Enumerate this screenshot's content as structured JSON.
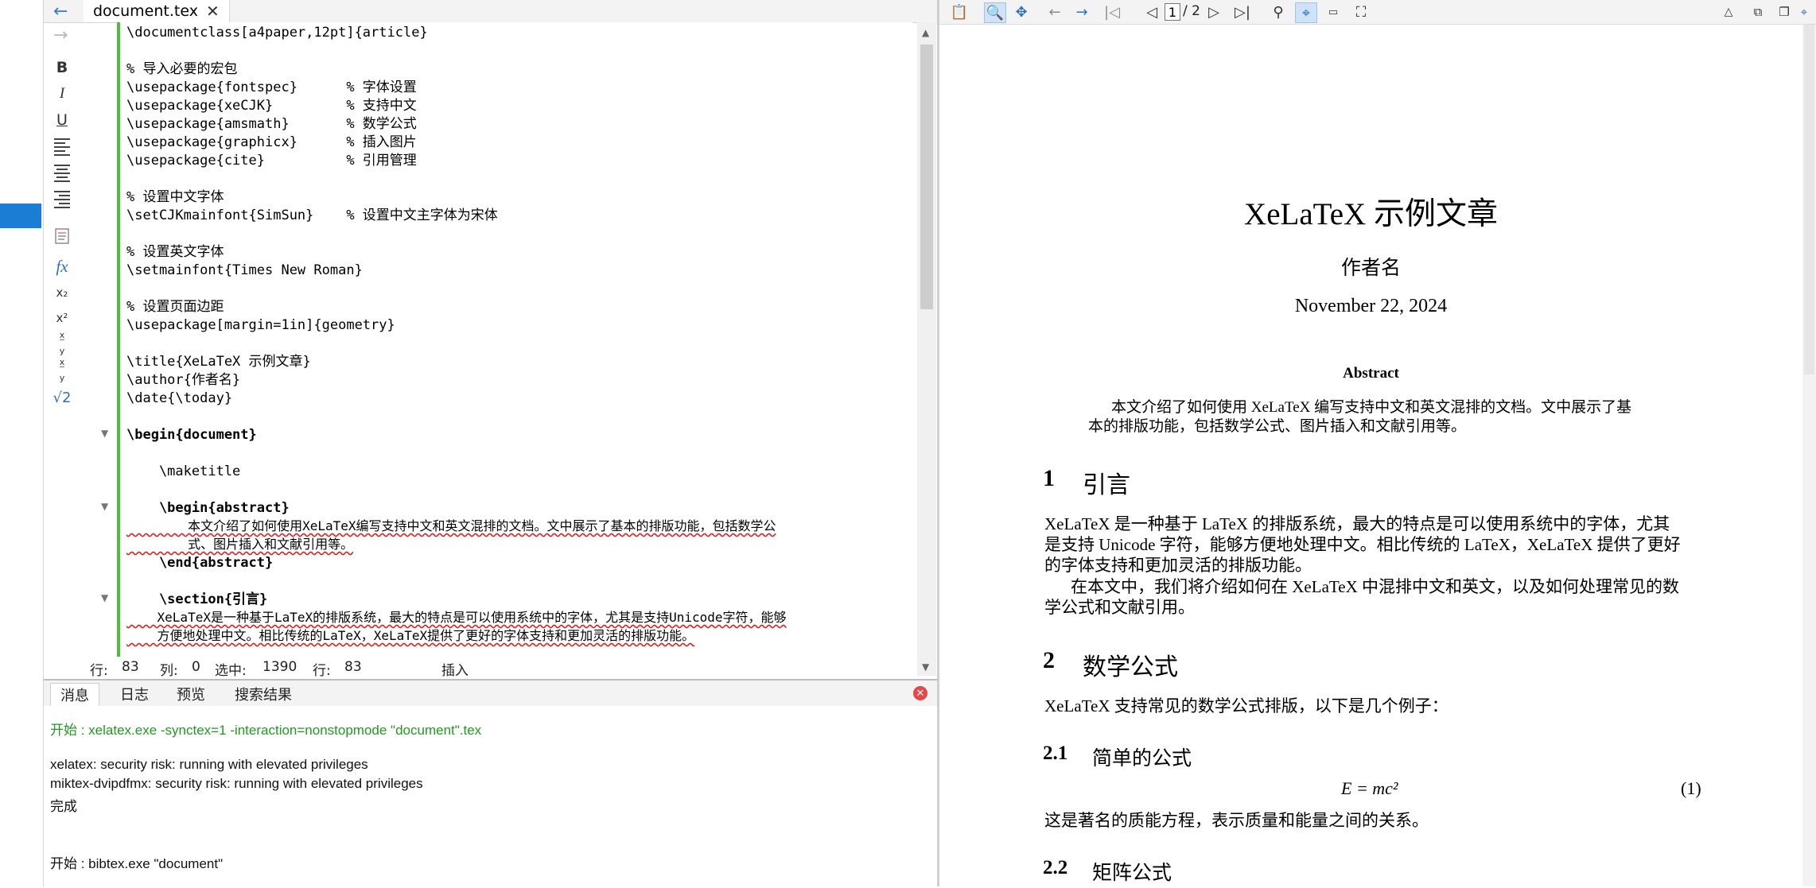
{
  "editor": {
    "tab_label": "document.tex",
    "code_lines": [
      "\\documentclass[a4paper,12pt]{article}",
      "",
      "% 导入必要的宏包",
      "\\usepackage{fontspec}      % 字体设置",
      "\\usepackage{xeCJK}         % 支持中文",
      "\\usepackage{amsmath}       % 数学公式",
      "\\usepackage{graphicx}      % 插入图片",
      "\\usepackage{cite}          % 引用管理",
      "",
      "% 设置中文字体",
      "\\setCJKmainfont{SimSun}    % 设置中文主字体为宋体",
      "",
      "% 设置英文字体",
      "\\setmainfont{Times New Roman}",
      "",
      "% 设置页面边距",
      "\\usepackage[margin=1in]{geometry}",
      "",
      "\\title{XeLaTeX 示例文章}",
      "\\author{作者名}",
      "\\date{\\today}",
      "",
      "\\begin{document}",
      "",
      "    \\maketitle",
      "",
      "    \\begin{abstract}",
      "        本文介绍了如何使用XeLaTeX编写支持中文和英文混排的文档。文中展示了基本的排版功能，包括数学公",
      "        式、图片插入和文献引用等。",
      "    \\end{abstract}",
      "",
      "    \\section{引言}",
      "    XeLaTeX是一种基于LaTeX的排版系统，最大的特点是可以使用系统中的字体，尤其是支持Unicode字符，能够",
      "    方便地处理中文。相比传统的LaTeX，XeLaTeX提供了更好的字体支持和更加灵活的排版功能。"
    ],
    "status": {
      "row_label": "行:",
      "row_value": "83",
      "col_label": "列:",
      "col_value": "0",
      "sel_label": "选中:",
      "sel_value": "1390",
      "row2_label": "行:",
      "row2_value": "83",
      "mode": "插入"
    }
  },
  "messages": {
    "tabs": [
      "消息",
      "日志",
      "预览",
      "搜索结果"
    ],
    "lines": [
      {
        "text": "开始 : xelatex.exe -synctex=1 -interaction=nonstopmode \"document\".tex",
        "color": "#219a21"
      },
      {
        "text": "",
        "color": "#111111"
      },
      {
        "text": "xelatex: security risk: running with elevated privileges",
        "color": "#111111"
      },
      {
        "text": "miktex-dvipdfmx: security risk: running with elevated privileges",
        "color": "#111111"
      },
      {
        "text": "完成",
        "color": "#111111"
      },
      {
        "text": "",
        "color": "#111111"
      },
      {
        "text": "",
        "color": "#111111"
      },
      {
        "text": "开始 : bibtex.exe \"document\"",
        "color": "#111111"
      }
    ]
  },
  "viewer": {
    "page_current": "1",
    "page_total": "/ 2",
    "title": "XeLaTeX 示例文章",
    "author": "作者名",
    "date": "November 22, 2024",
    "abstract_heading": "Abstract",
    "abstract_lines": [
      "本文介绍了如何使用 XeLaTeX 编写支持中文和英文混排的文档。文中展示了基",
      "本的排版功能，包括数学公式、图片插入和文献引用等。"
    ],
    "section1_num": "1",
    "section1_title": "引言",
    "section1_lines": [
      "XeLaTeX 是一种基于 LaTeX 的排版系统，最大的特点是可以使用系统中的字体，尤其",
      "是支持 Unicode 字符，能够方便地处理中文。相比传统的 LaTeX，XeLaTeX 提供了更好",
      "的字体支持和更加灵活的排版功能。",
      "在本文中，我们将介绍如何在 XeLaTeX 中混排中文和英文，以及如何处理常见的数",
      "学公式和文献引用。"
    ],
    "section2_num": "2",
    "section2_title": "数学公式",
    "section2_intro": "XeLaTeX 支持常见的数学公式排版，以下是几个例子：",
    "sub21_num": "2.1",
    "sub21_title": "简单的公式",
    "equation": "E = mc²",
    "equation_number": "(1)",
    "sub21_text": "这是著名的质能方程，表示质量和能量之间的关系。",
    "sub22_num": "2.2",
    "sub22_title": "矩阵公式"
  }
}
